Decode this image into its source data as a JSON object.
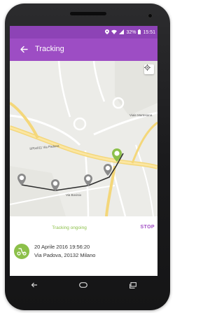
{
  "status_bar": {
    "battery": "32%",
    "time": "15:51"
  },
  "app_bar": {
    "title": "Tracking"
  },
  "map": {
    "labels": {
      "road_top": "Viale Martesana",
      "road_sp": "SPbs011 Via Padana",
      "road_bottom": "Via Bovisio"
    }
  },
  "tracking": {
    "status": "Tracking ongoing",
    "stop_label": "STOP",
    "date": "20 Aprile 2016 19:56:20",
    "address": "Via Padova, 20132 Milano"
  },
  "colors": {
    "status_bar": "#8d43b6",
    "app_bar": "#9d4dc4",
    "tracking_green": "#8cc04a",
    "stop_purple": "#a04cc4",
    "marker_grey": "#8a8a8a"
  }
}
